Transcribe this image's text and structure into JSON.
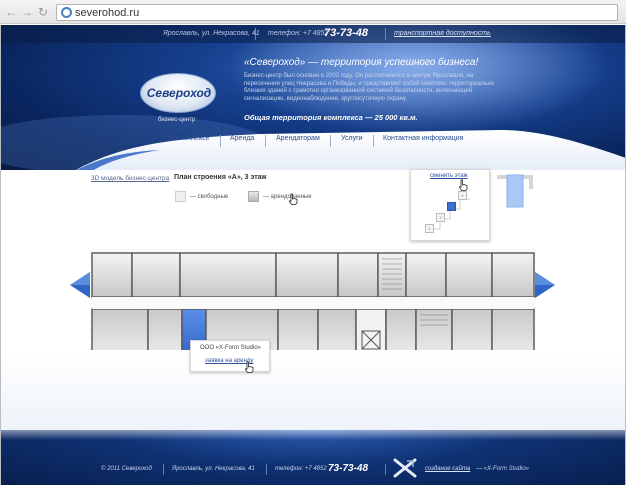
{
  "browser": {
    "url": "severohod.ru"
  },
  "topbar": {
    "address": "Ярославль, ул. Некрасова, 41",
    "phone_label": "телефон: +7 4852",
    "phone_number": "73-73-48",
    "transport_link": "транспортная доступность"
  },
  "logo": {
    "text": "Североход",
    "subtitle": "бизнес-центр"
  },
  "hero": {
    "slogan": "«Североход» — территория успешного бизнеса!",
    "intro": "Бизнес-центр был основан в 2002 году. Он расположился в центре Ярославля, на пересечении улиц Некрасова и Победы, и представляет собой комплекс территориально близких зданий с грамотно организованной системой безопасности, включающей сигнализацию, видеонаблюдение, круглосуточную охрану.",
    "area": "Общая территория комплекса — 25 000 кв.м."
  },
  "menu": {
    "items": [
      {
        "label": "О комплексе"
      },
      {
        "label": "Аренда"
      },
      {
        "label": "Арендаторам"
      },
      {
        "label": "Услуги"
      },
      {
        "label": "Контактная информация"
      }
    ]
  },
  "plan": {
    "model_link": "3D модель бизнес-центра",
    "title": "План строения «А», 3 этаж",
    "legend_free": "— свободные",
    "legend_rented": "— арендованные",
    "change_floor": "сменить этаж",
    "floors": [
      "1",
      "2",
      "3",
      "4"
    ],
    "active_floor": "3"
  },
  "tenant": {
    "name": "ООО «X-Form Studio»",
    "link": "заявка на аренду"
  },
  "footer": {
    "copyright": "© 2011 Североход",
    "address": "Ярославль, ул. Некрасова, 41",
    "phone_label": "телефон: +7 4852",
    "phone_number": "73-73-48",
    "site_link": "создание сайта",
    "studio": "— «X-Form Studio»"
  },
  "colors": {
    "brand_blue": "#16408e",
    "accent_blue": "#3a6fd2",
    "link": "#2a4f9c"
  }
}
